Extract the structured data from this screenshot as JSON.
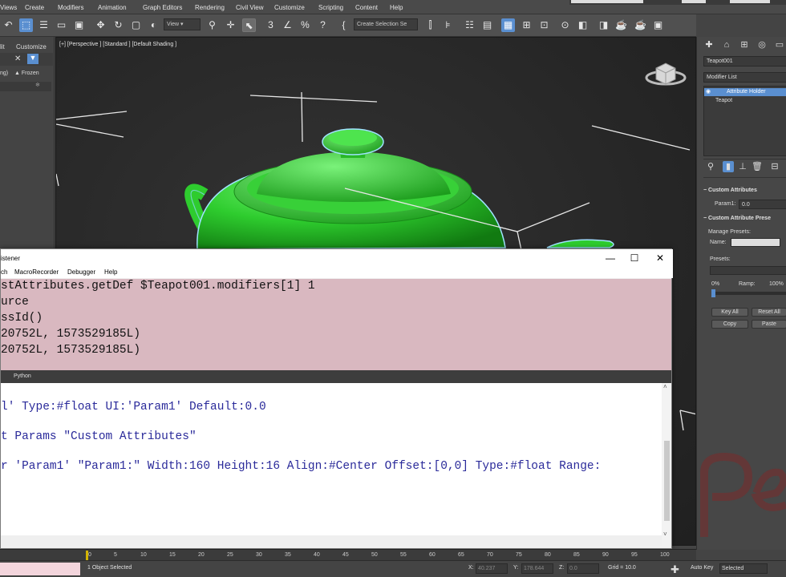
{
  "menu": [
    "Views",
    "Create",
    "Modifiers",
    "Animation",
    "Graph Editors",
    "Rendering",
    "Civil View",
    "Customize",
    "Scripting",
    "Content",
    "Help"
  ],
  "toolbar": {
    "view_dropdown": "View",
    "selection_set": "Create Selection Se",
    "snap_3": "3",
    "snap_percent": "%",
    "snap_spin": "?"
  },
  "left_panel": {
    "tab_1": "lit",
    "tab_2": "Customize",
    "row_label": "ng)",
    "frozen": "Frozen"
  },
  "viewport": {
    "label": "[+] [Perspective ] [Standard ] [Default Shading ]"
  },
  "command_panel": {
    "object_name": "Teapot001",
    "modifier_list": "Modifier List",
    "stack": [
      "Attribute Holder",
      "Teapot"
    ],
    "custom_attributes_title": "Custom Attributes",
    "param_label": "Param1:",
    "param_value": "0.0",
    "presets_title": "Custom Attribute Prese",
    "manage_presets": "Manage Presets:",
    "name_label": "Name:",
    "presets_label": "Presets:",
    "pct_0": "0%",
    "ramp": "Ramp:",
    "pct_100": "100%",
    "key_all": "Key All",
    "reset_all": "Reset All",
    "copy": "Copy",
    "paste": "Paste"
  },
  "listener": {
    "title": "istener",
    "menu": [
      "ch",
      "MacroRecorder",
      "Debugger",
      "Help"
    ],
    "top_lines": [
      "stAttributes.getDef $Teapot001.modifiers[1] 1",
      "urce",
      "ssId()",
      "20752L, 1573529185L)",
      "20752L, 1573529185L)"
    ],
    "split_label": "Python",
    "bottom_lines": [
      "l' Type:#float UI:'Param1' Default:0.0",
      "t Params \"Custom Attributes\"",
      "r 'Param1' \"Param1:\" Width:160 Height:16 Align:#Center Offset:[0,0] Type:#float Range:"
    ]
  },
  "timeline": {
    "ticks": [
      "0",
      "5",
      "10",
      "15",
      "20",
      "25",
      "30",
      "35",
      "40",
      "45",
      "50",
      "55",
      "60",
      "65",
      "70",
      "75",
      "80",
      "85",
      "90",
      "95",
      "100"
    ]
  },
  "status": {
    "selected_text": "1 Object Selected",
    "x_label": "X:",
    "x_value": "40.237",
    "y_label": "Y:",
    "y_value": "178.644",
    "z_label": "Z:",
    "z_value": "0.0",
    "grid": "Grid = 10.0",
    "auto_key": "Auto Key",
    "selected_dropdown": "Selected"
  },
  "colors": {
    "teapot": "#2ecc2e",
    "active_blue": "#5a8fd0",
    "listener_pink": "#d9b8c0",
    "code_blue": "#2a2a9a"
  }
}
